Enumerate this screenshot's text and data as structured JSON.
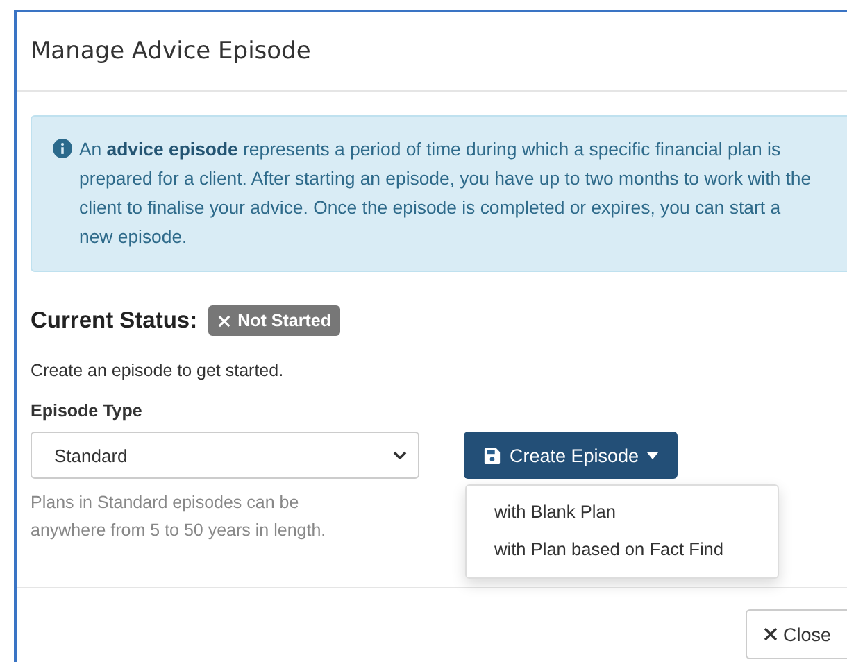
{
  "modal": {
    "title": "Manage Advice Episode"
  },
  "info_alert": {
    "text": "An **advice episode** represents a period of time during which a specific financial plan is prepared for a client. After starting an episode, you have up to two months to work with the client to finalise your advice. Once the episode is completed or expires, you can start a new episode."
  },
  "status": {
    "label": "Current Status:",
    "badge": "Not Started"
  },
  "intro": "Create an episode to get started.",
  "episode_type": {
    "label": "Episode Type",
    "value": "Standard",
    "help": "Plans in Standard episodes can be anywhere from 5 to 50 years in length."
  },
  "create_button": {
    "label": "Create Episode",
    "open": true,
    "menu": [
      {
        "label": "with Blank Plan"
      },
      {
        "label": "with Plan based on Fact Find"
      }
    ]
  },
  "footer": {
    "close_button": "Close"
  }
}
